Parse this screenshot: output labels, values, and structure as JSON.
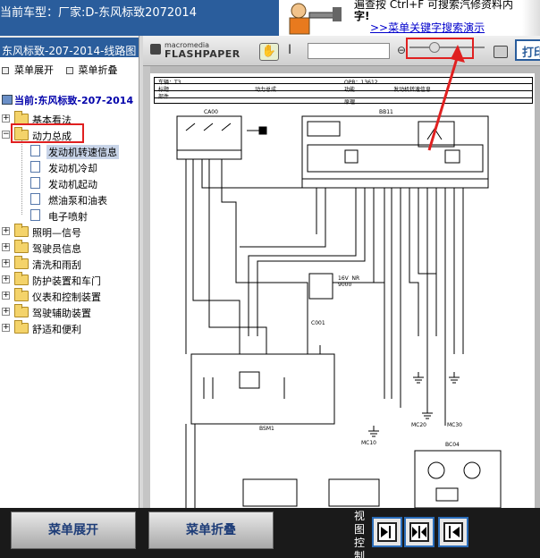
{
  "app": {
    "title": "当前车型：厂家:D-东风标致2072014"
  },
  "promo": {
    "line1": "遍查按 Ctrl+F 可搜索汽修资料内",
    "line2": "字!",
    "link": ">>菜单关键字搜索演示"
  },
  "left_panel": {
    "header": "东风标致-207-2014-线路图",
    "expand_all": "菜单展开",
    "collapse_all": "菜单折叠",
    "current": "当前:东风标致-207-2014",
    "tree": [
      {
        "label": "基本看法",
        "expanded": false
      },
      {
        "label": "动力总成",
        "expanded": true,
        "children": [
          {
            "label": "发动机转速信息",
            "selected": true
          },
          {
            "label": "发动机冷却"
          },
          {
            "label": "发动机起动"
          },
          {
            "label": "燃油泵和油表"
          },
          {
            "label": "电子喷射"
          }
        ]
      },
      {
        "label": "照明—信号",
        "expanded": false
      },
      {
        "label": "驾驶员信息",
        "expanded": false
      },
      {
        "label": "清洗和雨刮",
        "expanded": false
      },
      {
        "label": "防护装置和车门",
        "expanded": false
      },
      {
        "label": "仪表和控制装置",
        "expanded": false
      },
      {
        "label": "驾驶辅助装置",
        "expanded": false
      },
      {
        "label": "舒适和便利",
        "expanded": false
      }
    ]
  },
  "viewer": {
    "brand_top": "macromedia",
    "brand_bottom": "FLASHPAPER",
    "print_label": "打印",
    "page_header": {
      "row1_left": "车辆：T3",
      "row1_right": "OPR：13612",
      "row2": [
        "标题",
        "动力总成",
        "功能",
        "发动机转速信息"
      ],
      "row3": "部件",
      "schema": "原理"
    },
    "diagram_labels": {
      "c1": "CA00",
      "c2": "BB11",
      "c3": "C001",
      "c4": "BSM1",
      "c5": "MC10",
      "c6": "MC20",
      "c7": "MC30",
      "c8": "BC04",
      "fuse": "16V  NR\n9000"
    }
  },
  "bottom": {
    "expand_btn": "菜单展开",
    "collapse_btn": "菜单折叠",
    "view_control_label": "视图控制"
  },
  "colors": {
    "title_bar": "#2a5d9c",
    "highlight_box": "#e02020",
    "bottom_bar": "#1a1a1a"
  }
}
